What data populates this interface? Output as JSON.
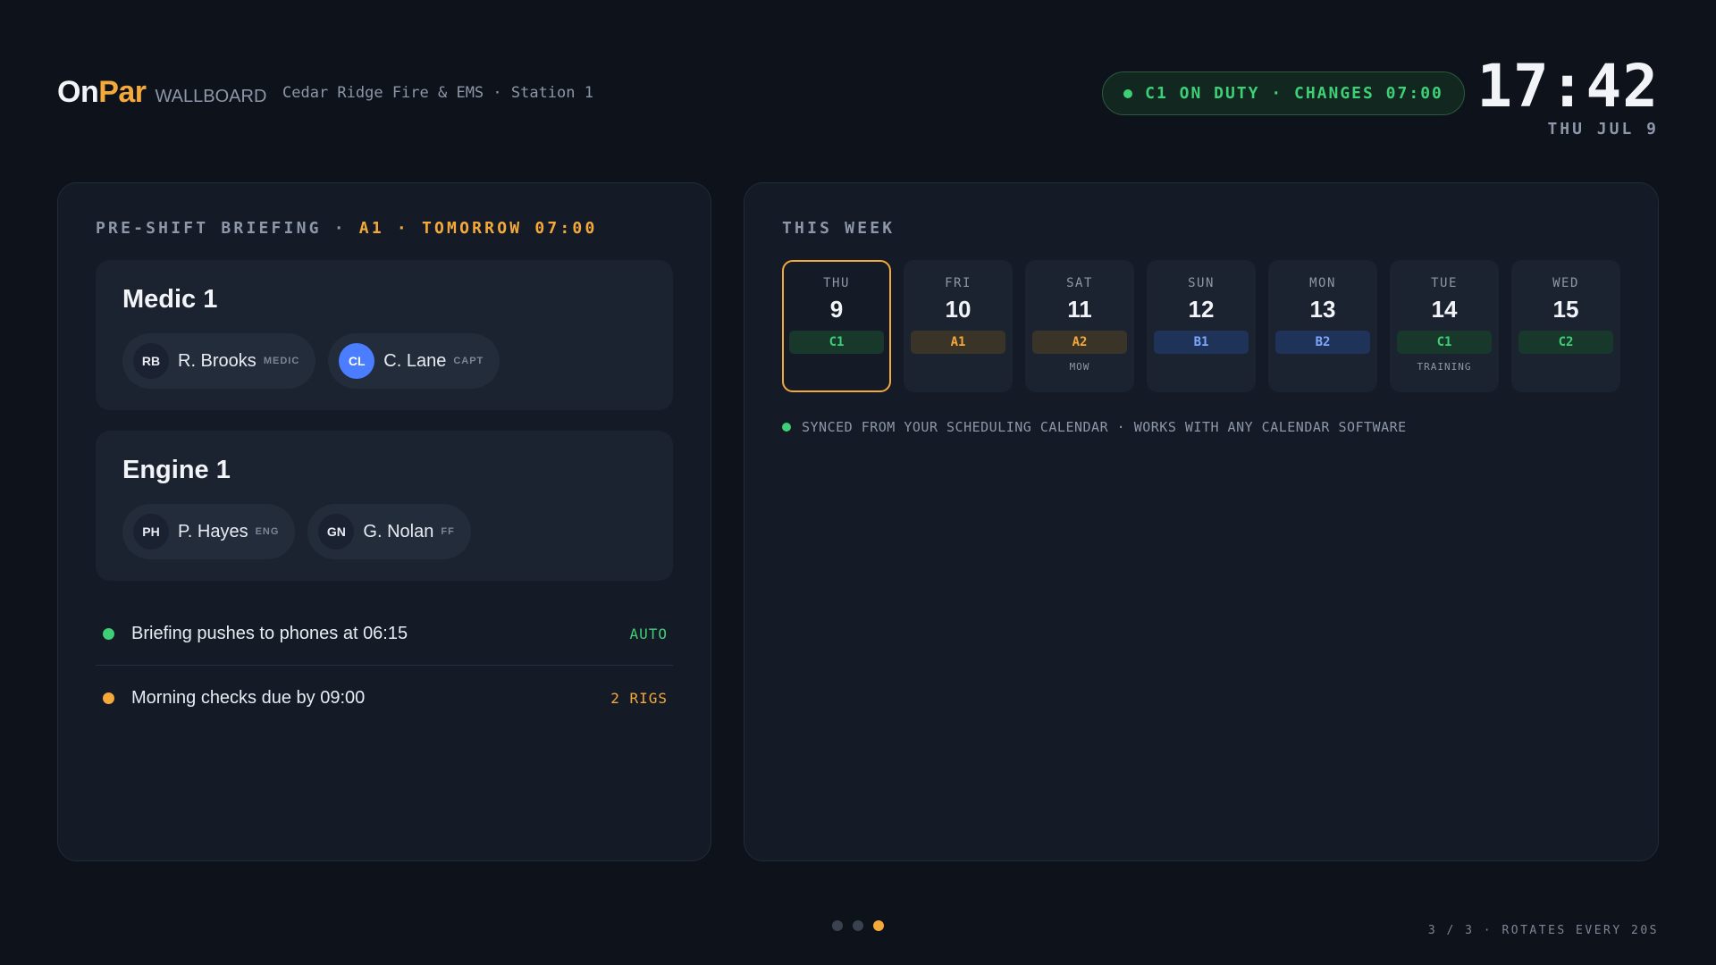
{
  "header": {
    "brand_on": "On",
    "brand_par": "Par",
    "brand_suffix": "WALLBOARD",
    "station": "Cedar Ridge Fire & EMS · Station 1",
    "duty_status": "C1 ON DUTY · CHANGES 07:00",
    "clock": "17:42",
    "date": "THU JUL 9"
  },
  "briefing": {
    "title_prefix": "PRE-SHIFT BRIEFING ·",
    "title_highlight": "A1 · TOMORROW 07:00",
    "units": [
      {
        "name": "Medic 1",
        "crew": [
          {
            "initials": "RB",
            "name": "R. Brooks",
            "role": "MEDIC"
          },
          {
            "initials": "CL",
            "name": "C. Lane",
            "role": "CAPT"
          }
        ]
      },
      {
        "name": "Engine 1",
        "crew": [
          {
            "initials": "PH",
            "name": "P. Hayes",
            "role": "ENG"
          },
          {
            "initials": "GN",
            "name": "G. Nolan",
            "role": "FF"
          }
        ]
      }
    ],
    "notes": [
      {
        "text": "Briefing pushes to phones at 06:15",
        "tag": "AUTO",
        "color": "#3ecf77"
      },
      {
        "text": "Morning checks due by 09:00",
        "tag": "2 RIGS",
        "color": "#f5a93a"
      }
    ]
  },
  "week": {
    "title": "THIS WEEK",
    "days": [
      {
        "name": "THU",
        "num": "9",
        "shift": "C1",
        "sub": ""
      },
      {
        "name": "FRI",
        "num": "10",
        "shift": "A1",
        "sub": ""
      },
      {
        "name": "SAT",
        "num": "11",
        "shift": "A2",
        "sub": "MOW"
      },
      {
        "name": "SUN",
        "num": "12",
        "shift": "B1",
        "sub": ""
      },
      {
        "name": "MON",
        "num": "13",
        "shift": "B2",
        "sub": ""
      },
      {
        "name": "TUE",
        "num": "14",
        "shift": "C1",
        "sub": "TRAINING"
      },
      {
        "name": "WED",
        "num": "15",
        "shift": "C2",
        "sub": ""
      }
    ],
    "sync_text": "SYNCED FROM YOUR SCHEDULING CALENDAR · WORKS WITH ANY CALENDAR SOFTWARE"
  },
  "footer": {
    "rotation": "3 / 3 · ROTATES EVERY 20S",
    "current_page": 3,
    "total_pages": 3
  },
  "colors": {
    "accent": "#f5a93a",
    "duty_green": "#3ecf77",
    "shift_a_bg": "#3a3428",
    "shift_a_fg": "#f5a93a",
    "shift_b_bg": "#1f3358",
    "shift_b_fg": "#7fa7ff",
    "shift_c_bg": "#17382b",
    "shift_c_fg": "#3ecf77"
  }
}
